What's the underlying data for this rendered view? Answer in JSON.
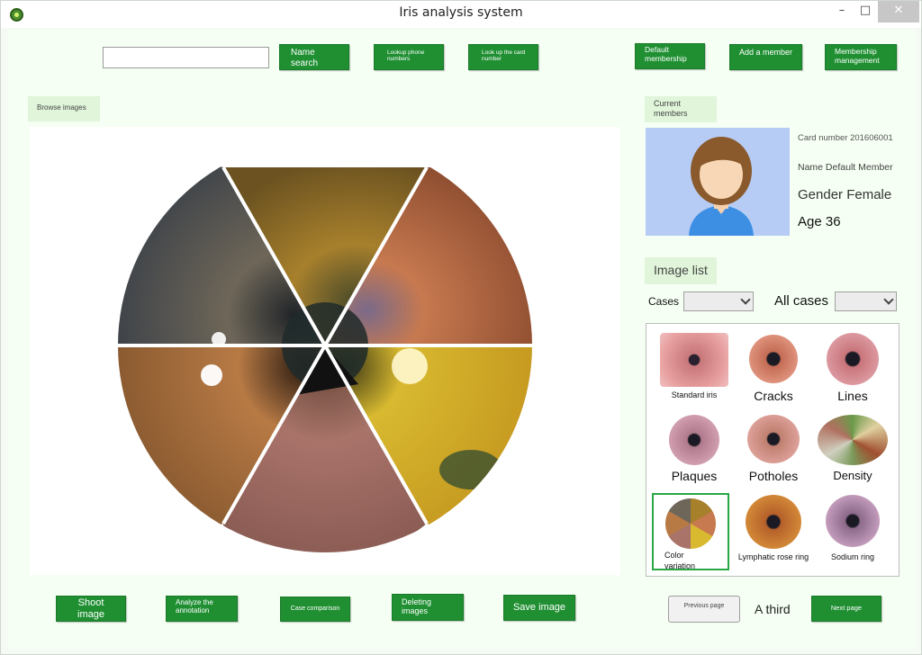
{
  "window": {
    "title": "Iris analysis system",
    "minimize": "–",
    "maximize": "□",
    "close": "✕"
  },
  "toolbar": {
    "search_placeholder": "",
    "name_search": "Name search",
    "lookup_phone": "Lookup phone numbers",
    "lookup_card": "Look up the card number",
    "default_membership": "Default membership",
    "add_member": "Add a member",
    "membership_management": "Membership management"
  },
  "browse": {
    "label": "Browse images"
  },
  "member": {
    "section_label": "Current members",
    "card": "Card number 201606001",
    "name": "Name Default Member",
    "gender": "Gender Female",
    "age": "Age 36"
  },
  "image_list": {
    "label": "Image list",
    "cases_label": "Cases",
    "cases_value": "",
    "all_cases_label": "All cases",
    "all_cases_value": "",
    "thumbnails": [
      {
        "caption": "Standard iris",
        "color": "#c7777a"
      },
      {
        "caption": "Cracks",
        "color": "#c46c55"
      },
      {
        "caption": "Lines",
        "color": "#c8757a"
      },
      {
        "caption": "Plaques",
        "color": "#b07a8c"
      },
      {
        "caption": "Potholes",
        "color": "#c08070"
      },
      {
        "caption": "Density",
        "color": "#7a9a5a"
      },
      {
        "caption": "Color variation",
        "color": "#d19a3a"
      },
      {
        "caption": "Lymphatic rose ring",
        "color": "#b5602a"
      },
      {
        "caption": "Sodium ring",
        "color": "#8c6a8a"
      }
    ],
    "selected_index": 6
  },
  "pagination": {
    "previous": "Previous page",
    "current": "A third",
    "next": "Next page"
  },
  "actions": {
    "shoot": "Shoot image",
    "analyze": "Analyze the annotation",
    "compare": "Case comparison",
    "delete": "Deleting images",
    "save": "Save image"
  },
  "colors": {
    "accent": "#1f8f32",
    "selected_border": "#28a745",
    "panel_bg": "#f5fff3"
  }
}
